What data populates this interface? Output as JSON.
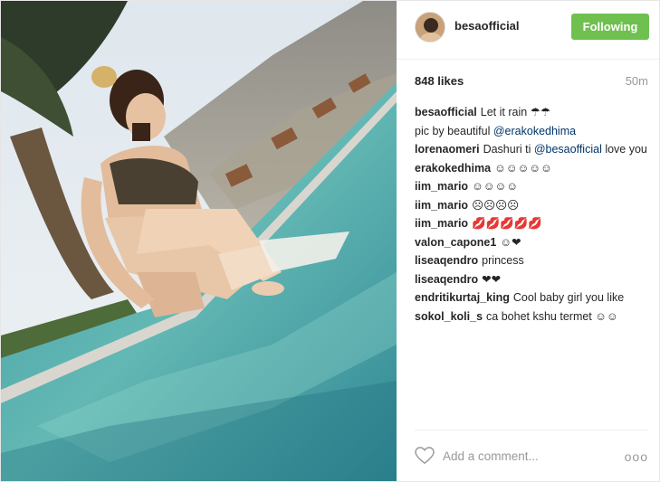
{
  "post": {
    "username": "besaofficial",
    "follow_label": "Following",
    "likes": "848 likes",
    "time_ago": "50m",
    "add_comment_placeholder": "Add a comment...",
    "more_options": "ooo",
    "colors": {
      "follow_button": "#70c050",
      "link": "#003569",
      "muted": "#999999"
    },
    "icons": [
      "heart-icon",
      "more-options-icon"
    ]
  },
  "comments": [
    {
      "user": "besaofficial",
      "parts": [
        {
          "t": "Let it rain ☂☂"
        }
      ]
    },
    {
      "user": "",
      "parts": [
        {
          "t": "pic by beautiful "
        },
        {
          "t": "@erakokedhima",
          "link": true
        }
      ]
    },
    {
      "user": "lorenaomeri",
      "parts": [
        {
          "t": "Dashuri ti "
        },
        {
          "t": "@besaofficial",
          "link": true
        },
        {
          "t": " love you"
        }
      ]
    },
    {
      "user": "erakokedhima",
      "parts": [
        {
          "t": "☺☺☺☺☺"
        }
      ]
    },
    {
      "user": "iim_mario",
      "parts": [
        {
          "t": "☺☺☺☺"
        }
      ]
    },
    {
      "user": "iim_mario",
      "parts": [
        {
          "t": "☹☹☹☹"
        }
      ]
    },
    {
      "user": "iim_mario",
      "parts": [
        {
          "t": "💋💋💋💋💋"
        }
      ]
    },
    {
      "user": "valon_capone1",
      "parts": [
        {
          "t": "☺❤"
        }
      ]
    },
    {
      "user": "liseaqendro",
      "parts": [
        {
          "t": "princess"
        }
      ]
    },
    {
      "user": "liseaqendro",
      "parts": [
        {
          "t": "❤❤"
        }
      ]
    },
    {
      "user": "endritikurtaj_king",
      "parts": [
        {
          "t": "Cool baby girl you like"
        }
      ]
    },
    {
      "user": "sokol_koli_s",
      "parts": [
        {
          "t": "ca bohet kshu termet ☺☺"
        }
      ]
    }
  ]
}
